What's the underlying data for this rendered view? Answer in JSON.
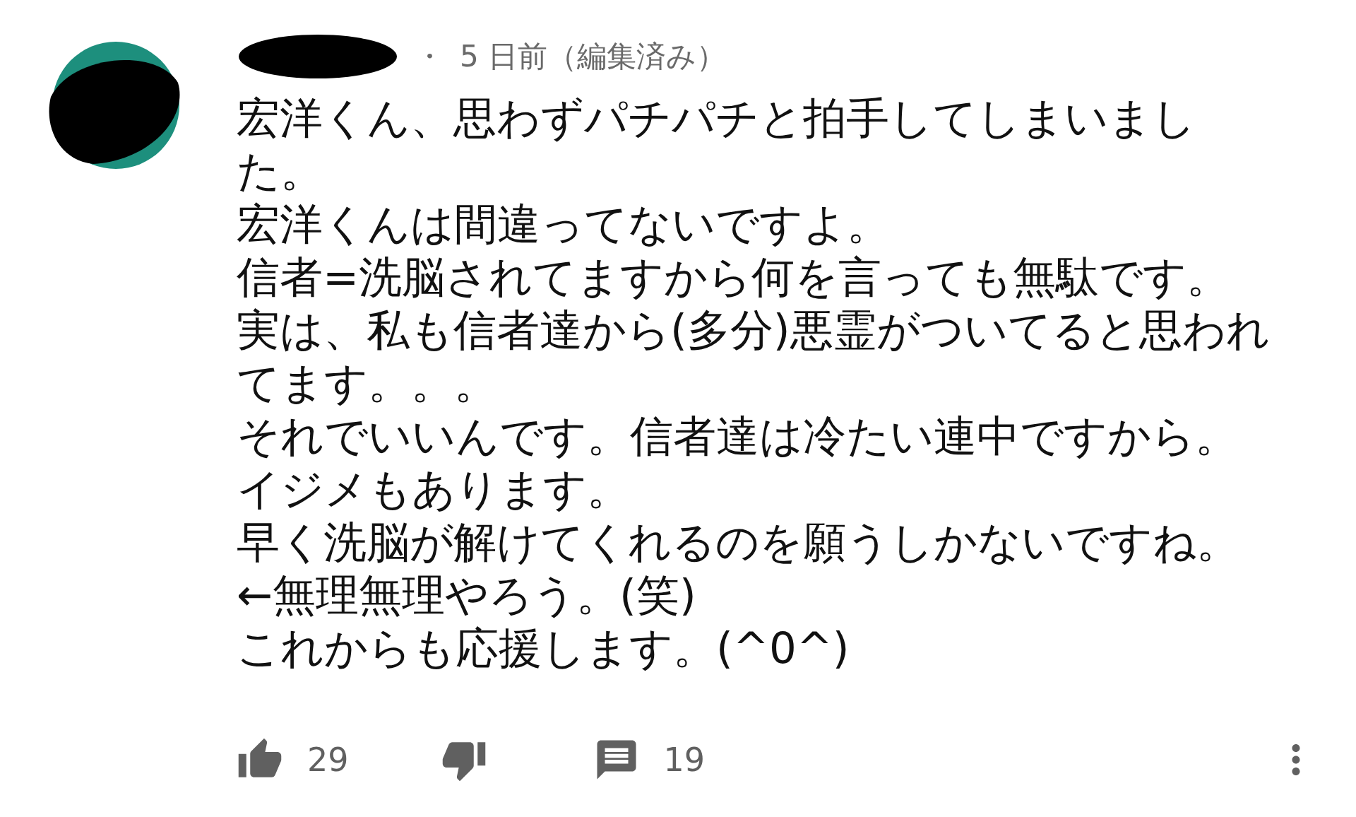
{
  "comment": {
    "separator": "・",
    "time": "5 日前（編集済み）",
    "lines": [
      "宏洋くん、思わずパチパチと拍手してしまいまし",
      "た。",
      "宏洋くんは間違ってないですよ。",
      "信者=洗脳されてますから何を言っても無駄です。",
      "実は、私も信者達から(多分)悪霊がついてると思われ",
      "てます。。。",
      "それでいいんです。信者達は冷たい連中ですから。",
      "イジメもあります。",
      "早く洗脳が解けてくれるのを願うしかないですね。",
      "←無理無理やろう。(笑)",
      "これからも応援します。(^0^)"
    ],
    "likes": "29",
    "replies": "19"
  }
}
